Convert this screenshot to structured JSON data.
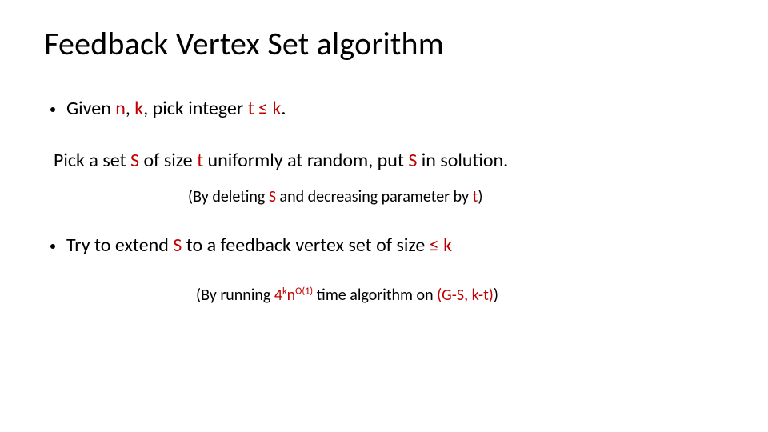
{
  "title": "Feedback Vertex Set algorithm",
  "bullet1": {
    "t1": "Given ",
    "n": "n",
    "t2": ", ",
    "k": "k",
    "t3": ", pick integer ",
    "tk": "t ≤ k",
    "t4": "."
  },
  "line2": {
    "t1": "Pick a set ",
    "S": "S",
    "t2": " of size ",
    "tvar": "t",
    "t3": " uniformly at random, put ",
    "S2": "S",
    "t4": " in solution."
  },
  "sub1": {
    "t1": "(By deleting ",
    "S": "S",
    "t2": " and decreasing parameter by ",
    "tvar": "t",
    "t3": ")"
  },
  "bullet2": {
    "t1": "Try to extend ",
    "S": "S",
    "t2": " to a feedback vertex set of size ",
    "lek": "≤ k"
  },
  "sub2": {
    "t1": "(By running ",
    "four": "4",
    "sup1": "k",
    "nn": "n",
    "sup2": "O(1)",
    "t2": " time algorithm on ",
    "paren": "(G-S, k-t)",
    "t3": ")"
  }
}
